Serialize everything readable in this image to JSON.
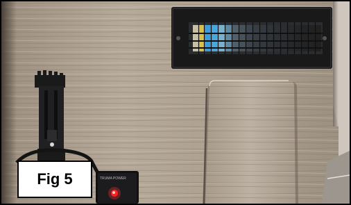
{
  "figure": {
    "caption": "Fig 5",
    "tiny_label": "TRUMA POWER"
  },
  "colors": {
    "wood_light": "#b7ab9b",
    "wood_dark": "#8f8272",
    "vent_black": "#1c1c1d",
    "led_red": "#ff2020"
  }
}
